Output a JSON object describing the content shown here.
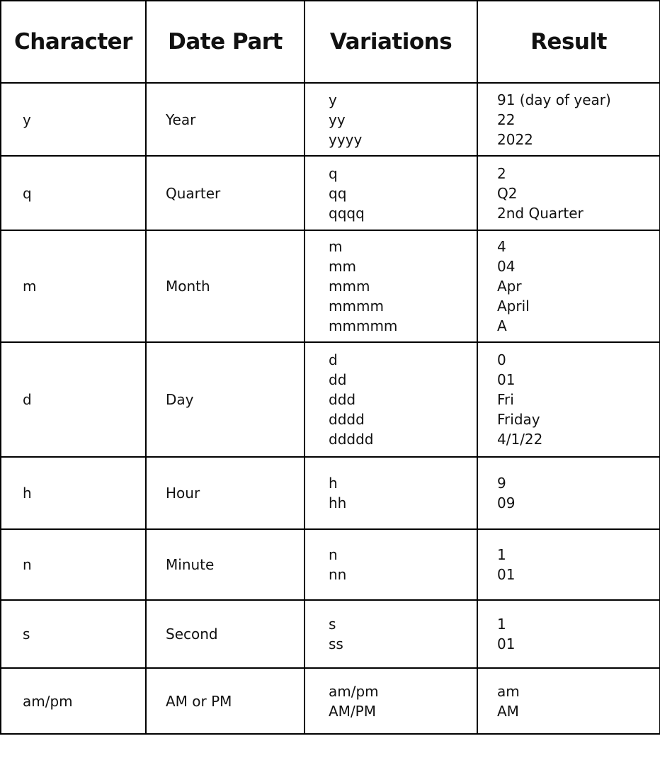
{
  "headers": [
    "Character",
    "Date Part",
    "Variations",
    "Result"
  ],
  "rows": [
    {
      "character": "y",
      "date_part": "Year",
      "variations": [
        "y",
        "yy",
        "yyyy"
      ],
      "results": [
        "91 (day of year)",
        "22",
        "2022"
      ]
    },
    {
      "character": "q",
      "date_part": "Quarter",
      "variations": [
        "q",
        "qq",
        "qqqq"
      ],
      "results": [
        "2",
        "Q2",
        "2nd Quarter"
      ]
    },
    {
      "character": "m",
      "date_part": "Month",
      "variations": [
        "m",
        "mm",
        "mmm",
        "mmmm",
        "mmmmm"
      ],
      "results": [
        "4",
        "04",
        "Apr",
        "April",
        "A"
      ]
    },
    {
      "character": "d",
      "date_part": "Day",
      "variations": [
        "d",
        "dd",
        "ddd",
        "dddd",
        "ddddd"
      ],
      "results": [
        "0",
        "01",
        "Fri",
        "Friday",
        "4/1/22"
      ]
    },
    {
      "character": "h",
      "date_part": "Hour",
      "variations": [
        "h",
        "hh"
      ],
      "results": [
        "9",
        "09"
      ]
    },
    {
      "character": "n",
      "date_part": "Minute",
      "variations": [
        "n",
        "nn"
      ],
      "results": [
        "1",
        "01"
      ]
    },
    {
      "character": "s",
      "date_part": "Second",
      "variations": [
        "s",
        "ss"
      ],
      "results": [
        "1",
        "01"
      ]
    },
    {
      "character": "am/pm",
      "date_part": "AM or PM",
      "variations": [
        "am/pm",
        "AM/PM"
      ],
      "results": [
        "am",
        "AM"
      ]
    }
  ]
}
